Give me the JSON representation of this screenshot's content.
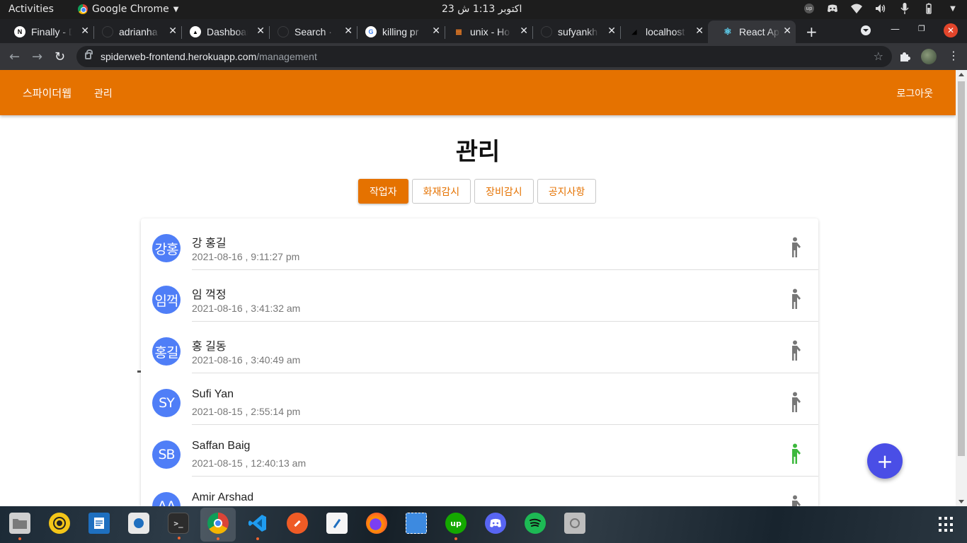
{
  "system_bar": {
    "activities": "Activities",
    "app_name": "Google Chrome",
    "clock": "23 اکتوبر  1:13 ش"
  },
  "browser": {
    "tabs": [
      {
        "label": "Finally - D",
        "icon": "n-icon"
      },
      {
        "label": "adrianha",
        "icon": "github-icon"
      },
      {
        "label": "Dashboard",
        "icon": "triangle-icon"
      },
      {
        "label": "Search · J",
        "icon": "github-icon"
      },
      {
        "label": "killing pr",
        "icon": "google-icon"
      },
      {
        "label": "unix - Ho",
        "icon": "stackoverflow-icon"
      },
      {
        "label": "sufyankh",
        "icon": "github-icon"
      },
      {
        "label": "localhost",
        "icon": "triangle-icon"
      },
      {
        "label": "React App",
        "icon": "react-icon"
      }
    ],
    "active_tab_index": 8,
    "url_host": "spiderweb-frontend.herokuapp.com",
    "url_path": "/management"
  },
  "app": {
    "brand": "스파이더웹",
    "nav_manage": "관리",
    "logout": "로그아웃",
    "accent_color": "#e57200",
    "page_title": "관리",
    "segments": [
      {
        "label": "작업자",
        "active": true
      },
      {
        "label": "화재감시",
        "active": false
      },
      {
        "label": "장비감시",
        "active": false
      },
      {
        "label": "공지사항",
        "active": false
      }
    ],
    "workers": [
      {
        "initials": "강홍",
        "name": "강 홍길",
        "time": "2021-08-16 , 9:11:27 pm",
        "active": false
      },
      {
        "initials": "임꺽",
        "name": "임 꺽정",
        "time": "2021-08-16 , 3:41:32 am",
        "active": false
      },
      {
        "initials": "홍길",
        "name": "홍 길동",
        "time": "2021-08-16 , 3:40:49 am",
        "active": false
      },
      {
        "initials": "SY",
        "name": "Sufi Yan",
        "time": "2021-08-15 , 2:55:14 pm",
        "active": false
      },
      {
        "initials": "SB",
        "name": "Saffan Baig",
        "time": "2021-08-15 , 12:40:13 am",
        "active": true
      },
      {
        "initials": "AA",
        "name": "Amir Arshad",
        "time": "",
        "active": false
      }
    ],
    "fab_icon": "plus-icon"
  },
  "dock": {
    "items": [
      "files-icon",
      "rhythmbox-icon",
      "libreoffice-writer-icon",
      "software-store-icon",
      "terminal-icon",
      "chrome-icon",
      "vscode-icon",
      "postman-icon",
      "text-editor-icon",
      "firefox-icon",
      "screenshot-icon",
      "upwork-icon",
      "discord-icon",
      "spotify-icon",
      "disk-icon"
    ]
  }
}
